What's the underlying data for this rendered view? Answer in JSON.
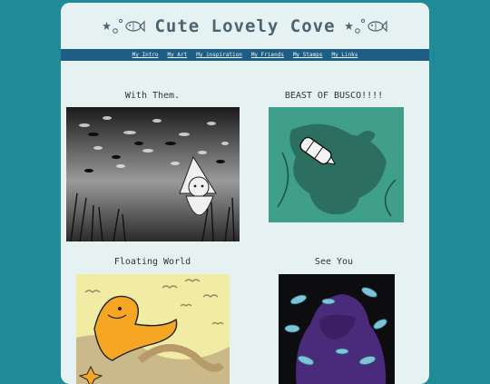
{
  "site": {
    "title": "Cute Lovely Cove"
  },
  "nav": {
    "links": [
      "My Intro",
      "My Art",
      "My inspiration",
      "My Friends",
      "My Stamps",
      "My Links"
    ]
  },
  "gallery": {
    "items": [
      {
        "caption": "With Them."
      },
      {
        "caption": "BEAST OF BUSCO!!!!"
      },
      {
        "caption": "Floating World"
      },
      {
        "caption": "See You"
      }
    ]
  },
  "colors": {
    "background": "#1f8a98",
    "page": "#e6f2f1",
    "navbar": "#1e5e84",
    "title": "#4c6470"
  }
}
